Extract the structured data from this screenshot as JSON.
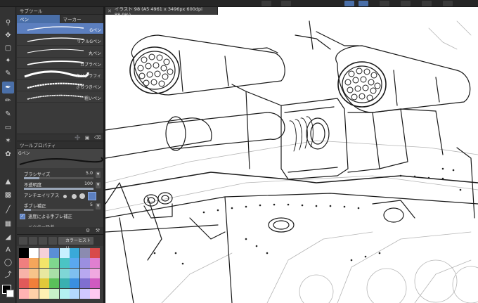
{
  "document": {
    "tab_title": "イラスト 98 (A5 4961 x 3496px 600dpi 88.9%)"
  },
  "subtool": {
    "title": "サブツール",
    "tabs": [
      {
        "label": "ペン",
        "active": true
      },
      {
        "label": "マーカー",
        "active": false
      }
    ],
    "brushes": [
      {
        "label": "Gペン",
        "active": true
      },
      {
        "label": "リアルGペン",
        "active": false
      },
      {
        "label": "丸ペン",
        "active": false
      },
      {
        "label": "カブラペン",
        "active": false
      },
      {
        "label": "カリグラフィ",
        "active": false
      },
      {
        "label": "ざらつきペン",
        "active": false
      },
      {
        "label": "粗いペン",
        "active": false
      }
    ]
  },
  "toolprop": {
    "title": "ツールプロパティ",
    "preview_label": "Gペン",
    "brush_size": {
      "label": "ブラシサイズ",
      "value": "5.0",
      "fill": 0.22
    },
    "opacity": {
      "label": "不透明度",
      "value": "100",
      "fill": 1.0
    },
    "antialias": {
      "label": "アンチエイリアス"
    },
    "stabilization": {
      "label": "手ブレ補正",
      "value": "5",
      "fill": 0.1
    },
    "speed_stab": {
      "label": "速度による手ブレ補正",
      "checked": true
    },
    "vector": {
      "label": "ベクター吸着"
    }
  },
  "colorhist": {
    "title": "カラーヒストリ",
    "swatches": [
      "#000000",
      "#ffffff",
      "#f5d0d8",
      "#5a8fd6",
      "#c8f0ff",
      "#3aa9d9",
      "#8b8bb0",
      "#d84a4a",
      "#f07f7f",
      "#f5a65b",
      "#f3e46a",
      "#7fd68e",
      "#4bc4c4",
      "#5aa8f0",
      "#9b8fe0",
      "#e07fd0",
      "#f7b3a8",
      "#f7c48a",
      "#e8e8a0",
      "#a8e0a8",
      "#7fd6d6",
      "#7fc0f0",
      "#b8a8f0",
      "#f0a8e0",
      "#e05a5a",
      "#f07f3a",
      "#e0c83a",
      "#5ac05a",
      "#3ab0b0",
      "#3a8fe0",
      "#7f6fd0",
      "#d05ac0",
      "#ffb3b3",
      "#ffd0a8",
      "#fff0b3",
      "#c8f0c8",
      "#b3f0f0",
      "#b3d8ff",
      "#d0c8ff",
      "#ffc8f0"
    ]
  },
  "colors": {
    "accent": "#4a6fa8",
    "selection": "#5c7fbf",
    "main_color": "#000000",
    "sub_color": "#ffffff"
  },
  "toolbar_icons": [
    "zoom-icon",
    "move-icon",
    "select-icon",
    "magic-wand-icon",
    "eyedropper-icon",
    "pen-icon",
    "pencil-icon",
    "brush-icon",
    "eraser-icon",
    "decoration-icon",
    "blend-icon",
    "fill-icon",
    "gradient-icon",
    "figure-icon",
    "frame-icon",
    "ruler-icon",
    "text-icon",
    "balloon-icon",
    "correct-line-icon"
  ]
}
